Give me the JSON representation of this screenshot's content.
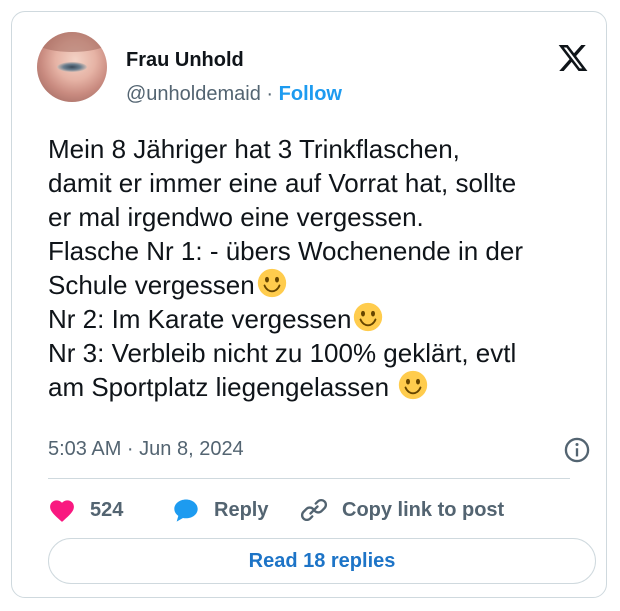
{
  "author": {
    "name": "Frau Unhold",
    "handle": "@unholdemaid",
    "separator": "·",
    "follow_label": "Follow"
  },
  "tweet": {
    "lines": [
      "Mein 8 Jähriger hat 3 Trinkflaschen,",
      "damit er immer eine auf Vorrat hat, sollte",
      "er mal irgendwo eine vergessen.",
      "Flasche Nr 1: - übers Wochenende in der",
      "Schule vergessen",
      "Nr 2: Im Karate vergessen",
      "Nr 3: Verbleib nicht zu 100% geklärt, evtl",
      "am Sportplatz liegengelassen"
    ],
    "timestamp": "5:03 AM · Jun 8, 2024"
  },
  "actions": {
    "like_count": "524",
    "reply_label": "Reply",
    "copy_label": "Copy link to post"
  },
  "read_replies_label": "Read 18 replies",
  "icons": {
    "logo": "x-logo-icon",
    "info": "info-icon",
    "like": "heart-icon",
    "reply": "speech-bubble-icon",
    "copy": "link-icon",
    "emoji": "slightly-smiling-face-icon"
  },
  "colors": {
    "like": "#f91880",
    "reply": "#1d9bf0",
    "follow": "#1d9bf0",
    "secondary_text": "#536471",
    "border": "#cfd9de"
  }
}
